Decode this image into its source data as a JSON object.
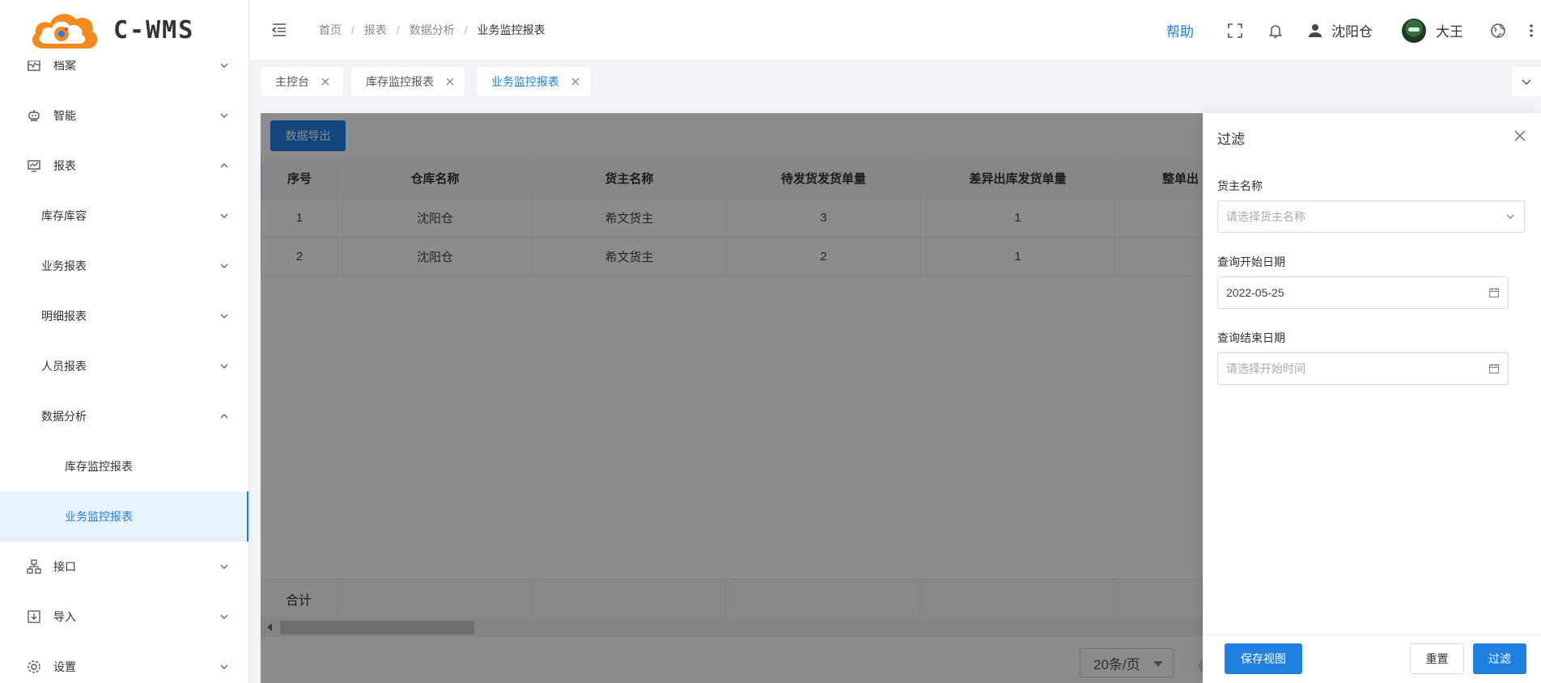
{
  "app": {
    "logo_text": "C-WMS"
  },
  "sidebar": {
    "items": [
      {
        "label": "档案",
        "icon": "archive-icon",
        "expanded": false
      },
      {
        "label": "智能",
        "icon": "robot-icon",
        "expanded": false
      },
      {
        "label": "报表",
        "icon": "chart-monitor-icon",
        "expanded": true
      },
      {
        "label": "库存库容",
        "expanded": false
      },
      {
        "label": "业务报表",
        "expanded": false
      },
      {
        "label": "明细报表",
        "expanded": false
      },
      {
        "label": "人员报表",
        "expanded": false
      },
      {
        "label": "数据分析",
        "expanded": true
      },
      {
        "label": "库存监控报表"
      },
      {
        "label": "业务监控报表",
        "active": true
      },
      {
        "label": "接口",
        "icon": "sitemap-icon",
        "expanded": false
      },
      {
        "label": "导入",
        "icon": "import-icon",
        "expanded": false
      },
      {
        "label": "设置",
        "icon": "gear-icon",
        "expanded": false
      }
    ]
  },
  "header": {
    "breadcrumb": [
      "首页",
      "报表",
      "数据分析",
      "业务监控报表"
    ],
    "help": "帮助",
    "warehouse": "沈阳仓",
    "user": "大王"
  },
  "tabs": [
    {
      "label": "主控台",
      "active": false
    },
    {
      "label": "库存监控报表",
      "active": false
    },
    {
      "label": "业务监控报表",
      "active": true
    }
  ],
  "main": {
    "export_button": "数据导出",
    "table": {
      "columns": [
        "序号",
        "仓库名称",
        "货主名称",
        "待发货发货单量",
        "差异出库发货单量",
        "整单出"
      ],
      "rows": [
        [
          "1",
          "沈阳仓",
          "希文货主",
          "3",
          "1",
          ""
        ],
        [
          "2",
          "沈阳仓",
          "希文货主",
          "2",
          "1",
          ""
        ]
      ],
      "summary_label": "合计"
    },
    "page_size": "20条/页",
    "pager_prev": "《"
  },
  "drawer": {
    "title": "过滤",
    "fields": [
      {
        "label": "货主名称",
        "value": "",
        "placeholder": "请选择货主名称",
        "type": "select"
      },
      {
        "label": "查询开始日期",
        "value": "2022-05-25",
        "placeholder": "",
        "type": "date"
      },
      {
        "label": "查询结束日期",
        "value": "",
        "placeholder": "请选择开始时间",
        "type": "date"
      }
    ],
    "save_view": "保存视图",
    "reset": "重置",
    "filter": "过滤"
  },
  "colors": {
    "primary": "#1f7fe0",
    "active_bg": "#e8f2fd"
  }
}
